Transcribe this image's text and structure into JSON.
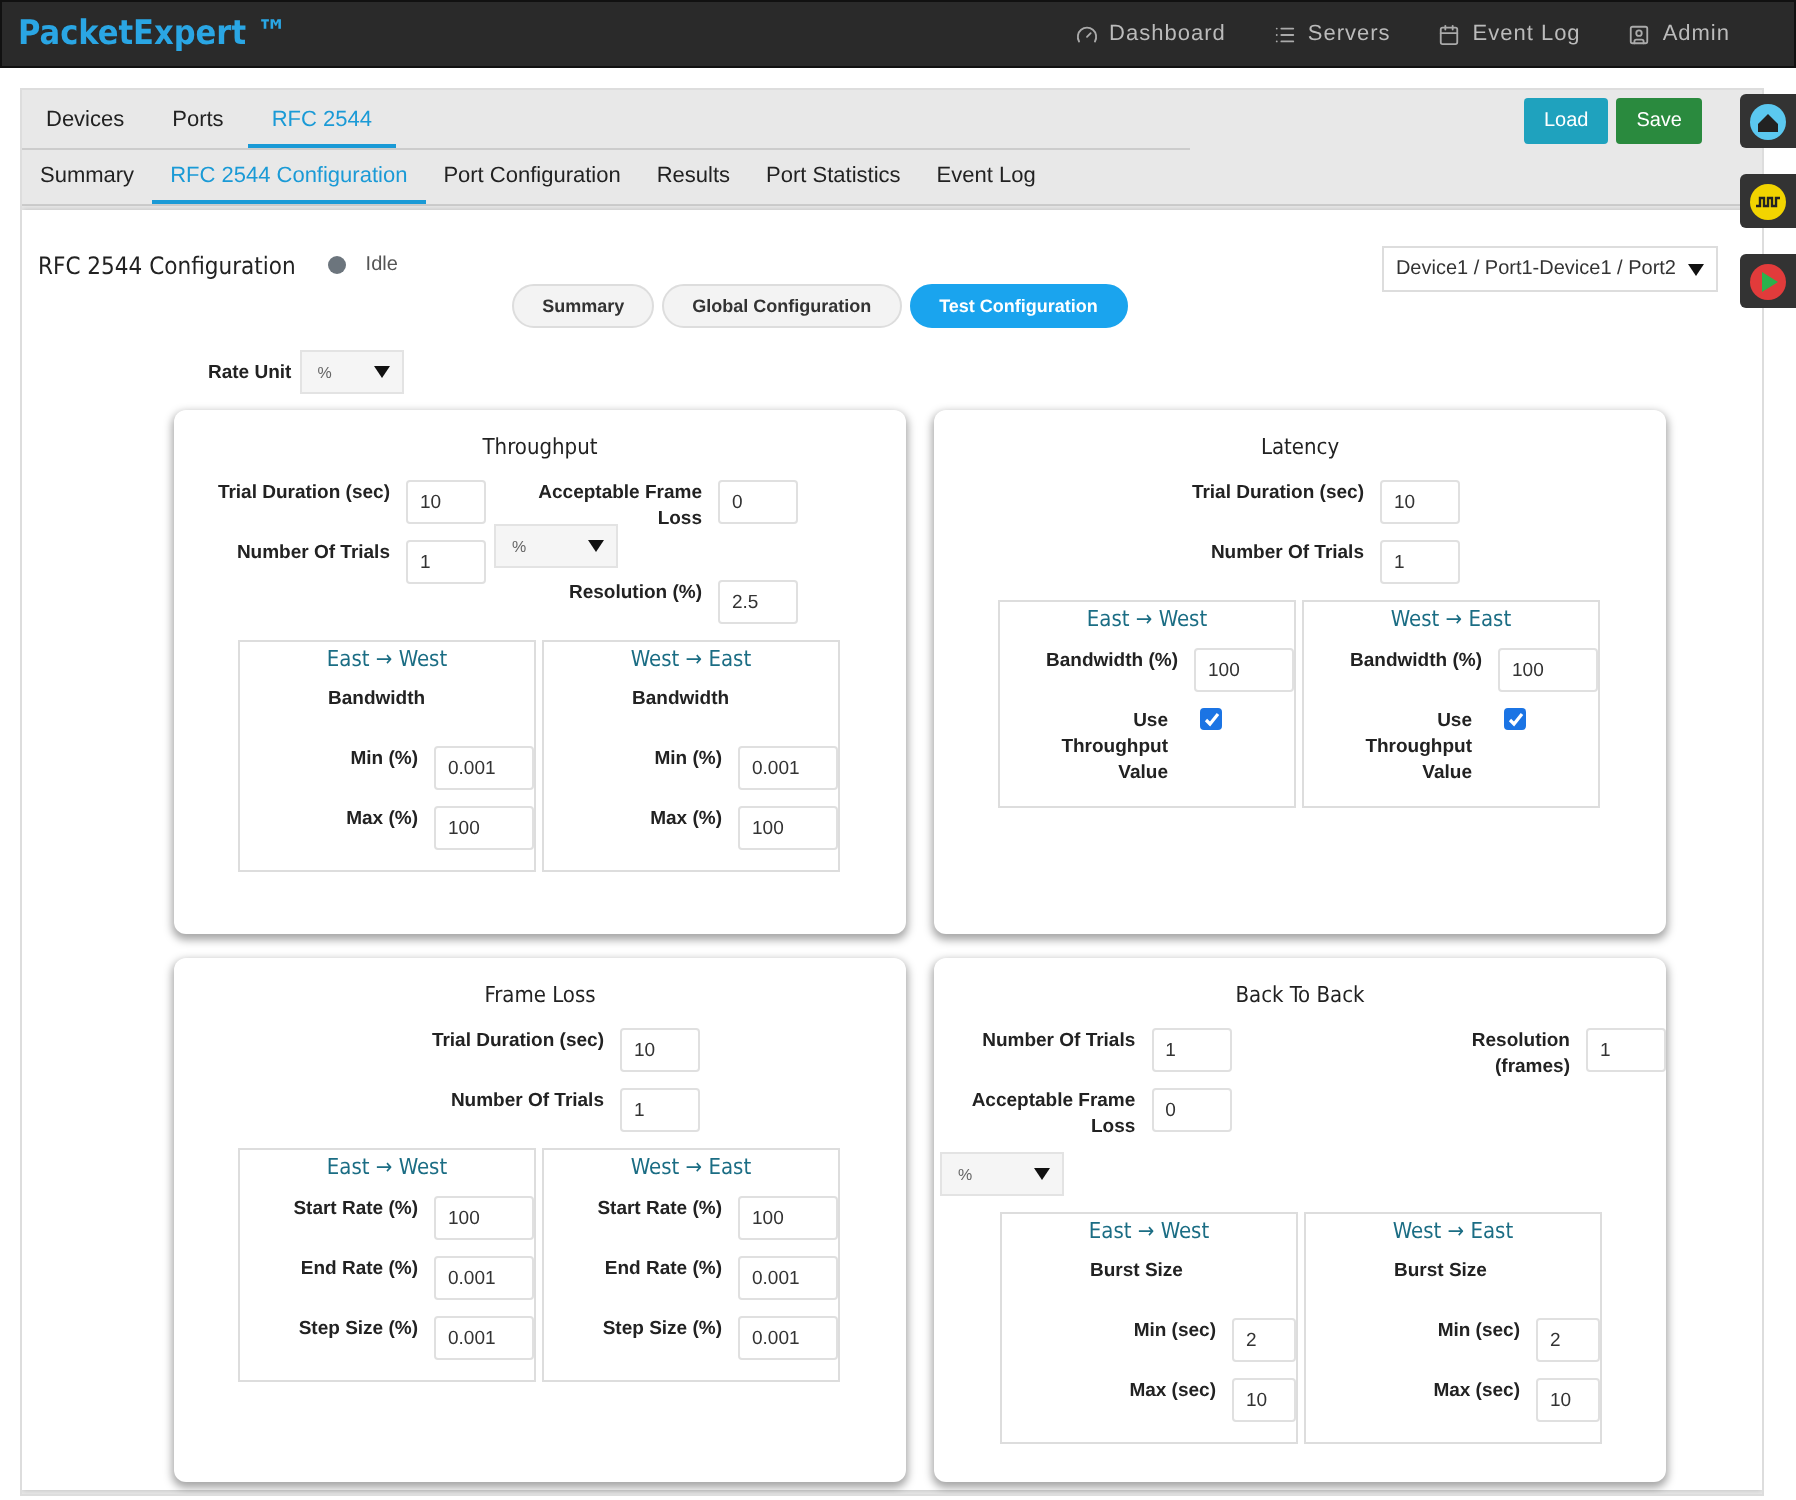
{
  "navbar": {
    "brand": "PacketExpert ™",
    "items": [
      "Dashboard",
      "Servers",
      "Event Log",
      "Admin"
    ]
  },
  "top_tabs": [
    {
      "label": "Devices",
      "selected": false
    },
    {
      "label": "Ports",
      "selected": false
    },
    {
      "label": "RFC 2544",
      "selected": true
    }
  ],
  "actions": [
    {
      "label": "Load",
      "kind": "info"
    },
    {
      "label": "Save",
      "kind": "success"
    }
  ],
  "sub_tabs": [
    {
      "label": "Summary",
      "selected": false
    },
    {
      "label": "RFC 2544 Configuration",
      "selected": true
    },
    {
      "label": "Port Configuration",
      "selected": false
    },
    {
      "label": "Results",
      "selected": false
    },
    {
      "label": "Port Statistics",
      "selected": false
    },
    {
      "label": "Event Log",
      "selected": false
    }
  ],
  "panel": {
    "title": "RFC 2544 Configuration",
    "status": "Idle",
    "port_select": "Device1 / Port1-Device1 / Port2",
    "pills": [
      {
        "label": "Summary",
        "selected": false
      },
      {
        "label": "Global Configuration",
        "selected": false
      },
      {
        "label": "Test Configuration",
        "selected": true
      }
    ],
    "rate_unit": {
      "label": "Rate Unit",
      "value": "%"
    },
    "cards": [
      {
        "title": "Throughput",
        "left": [
          {
            "kind": "field",
            "label": "Trial Duration (sec)",
            "value": "10"
          },
          {
            "kind": "field",
            "label": "Number Of Trials",
            "value": "1"
          }
        ],
        "right": [
          {
            "kind": "field",
            "label": "Acceptable Frame Loss",
            "value": "0"
          },
          {
            "kind": "select",
            "value": "%"
          },
          {
            "kind": "field",
            "label": "Resolution (%)",
            "value": "2.5"
          }
        ],
        "directions": [
          {
            "title": "East → West",
            "heading": "Bandwidth",
            "rows": [
              {
                "kind": "field",
                "label": "Min (%)",
                "value": "0.001"
              },
              {
                "kind": "field",
                "label": "Max (%)",
                "value": "100"
              }
            ]
          },
          {
            "title": "West → East",
            "heading": "Bandwidth",
            "rows": [
              {
                "kind": "field",
                "label": "Min (%)",
                "value": "0.001"
              },
              {
                "kind": "field",
                "label": "Max (%)",
                "value": "100"
              }
            ]
          }
        ]
      },
      {
        "title": "Latency",
        "left": [
          {
            "kind": "field",
            "label": "Trial Duration (sec)",
            "value": "10"
          },
          {
            "kind": "field",
            "label": "Number Of Trials",
            "value": "1"
          }
        ],
        "directions": [
          {
            "title": "East → West",
            "rows": [
              {
                "kind": "field",
                "label": "Bandwidth (%)",
                "value": "100"
              },
              {
                "kind": "checkbox",
                "label": "Use Throughput Value",
                "checked": true
              }
            ]
          },
          {
            "title": "West → East",
            "rows": [
              {
                "kind": "field",
                "label": "Bandwidth (%)",
                "value": "100"
              },
              {
                "kind": "checkbox",
                "label": "Use Throughput Value",
                "checked": true
              }
            ]
          }
        ]
      },
      {
        "title": "Frame Loss",
        "left": [
          {
            "kind": "field",
            "label": "Trial Duration (sec)",
            "value": "10"
          },
          {
            "kind": "field",
            "label": "Number Of Trials",
            "value": "1"
          }
        ],
        "directions": [
          {
            "title": "East → West",
            "rows": [
              {
                "kind": "field",
                "label": "Start Rate (%)",
                "value": "100"
              },
              {
                "kind": "field",
                "label": "End Rate (%)",
                "value": "0.001"
              },
              {
                "kind": "field",
                "label": "Step Size (%)",
                "value": "0.001"
              }
            ]
          },
          {
            "title": "West → East",
            "rows": [
              {
                "kind": "field",
                "label": "Start Rate (%)",
                "value": "100"
              },
              {
                "kind": "field",
                "label": "End Rate (%)",
                "value": "0.001"
              },
              {
                "kind": "field",
                "label": "Step Size (%)",
                "value": "0.001"
              }
            ]
          }
        ]
      },
      {
        "title": "Back To Back",
        "left": [
          {
            "kind": "field",
            "label": "Number Of Trials",
            "value": "1"
          },
          {
            "kind": "field",
            "label": "Acceptable Frame Loss",
            "value": "0"
          }
        ],
        "right": [
          {
            "kind": "field",
            "label": "Resolution (frames)",
            "value": "1"
          }
        ],
        "unit_select": "%",
        "directions": [
          {
            "title": "East → West",
            "heading": "Burst Size",
            "rows": [
              {
                "kind": "field",
                "label": "Min (sec)",
                "value": "2"
              },
              {
                "kind": "field",
                "label": "Max (sec)",
                "value": "10"
              }
            ]
          },
          {
            "title": "West → East",
            "heading": "Burst Size",
            "rows": [
              {
                "kind": "field",
                "label": "Min (sec)",
                "value": "2"
              },
              {
                "kind": "field",
                "label": "Max (sec)",
                "value": "10"
              }
            ]
          }
        ]
      }
    ]
  }
}
